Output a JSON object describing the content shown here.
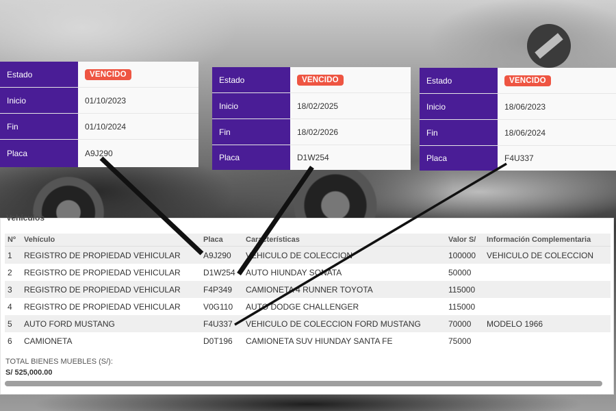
{
  "cards": [
    {
      "rows": [
        {
          "label": "Estado",
          "badge": "VENCIDO"
        },
        {
          "label": "Inicio",
          "value": "01/10/2023"
        },
        {
          "label": "Fin",
          "value": "01/10/2024"
        },
        {
          "label": "Placa",
          "value": "A9J290"
        }
      ]
    },
    {
      "rows": [
        {
          "label": "Estado",
          "badge": "VENCIDO"
        },
        {
          "label": "Inicio",
          "value": "18/02/2025"
        },
        {
          "label": "Fin",
          "value": "18/02/2026"
        },
        {
          "label": "Placa",
          "value": "D1W254"
        }
      ]
    },
    {
      "rows": [
        {
          "label": "Estado",
          "badge": "VENCIDO"
        },
        {
          "label": "Inicio",
          "value": "18/06/2023"
        },
        {
          "label": "Fin",
          "value": "18/06/2024"
        },
        {
          "label": "Placa",
          "value": "F4U337"
        }
      ]
    }
  ],
  "table": {
    "title": "Vehículos",
    "headers": [
      "Nº",
      "Vehículo",
      "Placa",
      "Características",
      "Valor S/",
      "Información Complementaria"
    ],
    "rows": [
      [
        "1",
        "REGISTRO DE PROPIEDAD VEHICULAR",
        "A9J290",
        "VEHICULO DE COLECCION",
        "100000",
        "VEHICULO DE COLECCION"
      ],
      [
        "2",
        "REGISTRO DE PROPIEDAD VEHICULAR",
        "D1W254",
        "AUTO HIUNDAY SONATA",
        "50000",
        ""
      ],
      [
        "3",
        "REGISTRO DE PROPIEDAD VEHICULAR",
        "F4P349",
        "CAMIONETA 4 RUNNER TOYOTA",
        "115000",
        ""
      ],
      [
        "4",
        "REGISTRO DE PROPIEDAD VEHICULAR",
        "V0G110",
        "AUTO DODGE CHALLENGER",
        "115000",
        ""
      ],
      [
        "5",
        "AUTO FORD MUSTANG",
        "F4U337",
        "VEHICULO DE COLECCION FORD MUSTANG",
        "70000",
        "MODELO 1966"
      ],
      [
        "6",
        "CAMIONETA",
        "D0T196",
        "CAMIONETA SUV HIUNDAY SANTA FE",
        "75000",
        ""
      ]
    ],
    "total_label": "TOTAL BIENES MUEBLES (S/):",
    "total_value": "S/ 525,000.00"
  },
  "colors": {
    "label_bg": "#4a1d96",
    "badge_bg": "#ee5542"
  }
}
